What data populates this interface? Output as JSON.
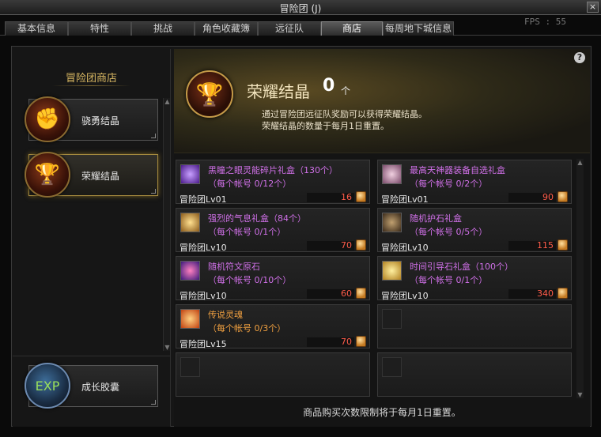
{
  "window": {
    "title": "冒险团 (J)",
    "close_label": "×"
  },
  "tabs": [
    {
      "label": "基本信息"
    },
    {
      "label": "特性"
    },
    {
      "label": "挑战"
    },
    {
      "label": "角色收藏簿"
    },
    {
      "label": "远征队"
    },
    {
      "label": "商店"
    },
    {
      "label": "每周地下城信息"
    }
  ],
  "fps": "FPS : 55",
  "sidebar": {
    "title": "冒险团商店",
    "items": [
      {
        "label": "骁勇结晶"
      },
      {
        "label": "荣耀结晶"
      },
      {
        "label": "成长胶囊"
      }
    ]
  },
  "banner": {
    "name": "荣耀结晶",
    "count": "0",
    "unit": "个",
    "desc_line1": "通过冒险团远征队奖励可以获得荣耀结晶。",
    "desc_line2": "荣耀结晶的数量于每月1日重置。",
    "help": "?"
  },
  "items": [
    {
      "name": "黑瞳之眼灵能碎片礼盒（130个）",
      "limit": "（每个帐号 0/12个）",
      "level": "冒险团Lv01",
      "price": "16",
      "icon": "purple-crystal-icon",
      "color": "#6a3aa8"
    },
    {
      "name": "最高天神器装备自选礼盒",
      "limit": "（每个帐号 0/2个）",
      "level": "冒险团Lv01",
      "price": "90",
      "icon": "gift-box-icon",
      "color": "#9a6a8a"
    },
    {
      "name": "强烈的气息礼盒（84个）",
      "limit": "（每个帐号 0/1个）",
      "level": "冒险团Lv10",
      "price": "70",
      "icon": "treasure-chest-icon",
      "color": "#b08a3a"
    },
    {
      "name": "随机护石礼盒",
      "limit": "（每个帐号 0/5个）",
      "level": "冒险团Lv10",
      "price": "115",
      "icon": "dark-chest-icon",
      "color": "#5a4a3a"
    },
    {
      "name": "随机符文原石",
      "limit": "（每个帐号 0/10个）",
      "level": "冒险团Lv10",
      "price": "60",
      "icon": "rune-stone-icon",
      "color": "#7a2a6a"
    },
    {
      "name": "时间引导石礼盒（100个）",
      "limit": "（每个帐号 0/1个）",
      "level": "冒险团Lv10",
      "price": "340",
      "icon": "golden-box-icon",
      "color": "#c4a040"
    },
    {
      "name": "传说灵魂",
      "limit": "（每个帐号 0/3个）",
      "level": "冒险团Lv15",
      "price": "70",
      "icon": "legendary-soul-icon",
      "color": "#d06a20"
    }
  ],
  "footer": "商品购买次数限制将于每月1日重置。"
}
